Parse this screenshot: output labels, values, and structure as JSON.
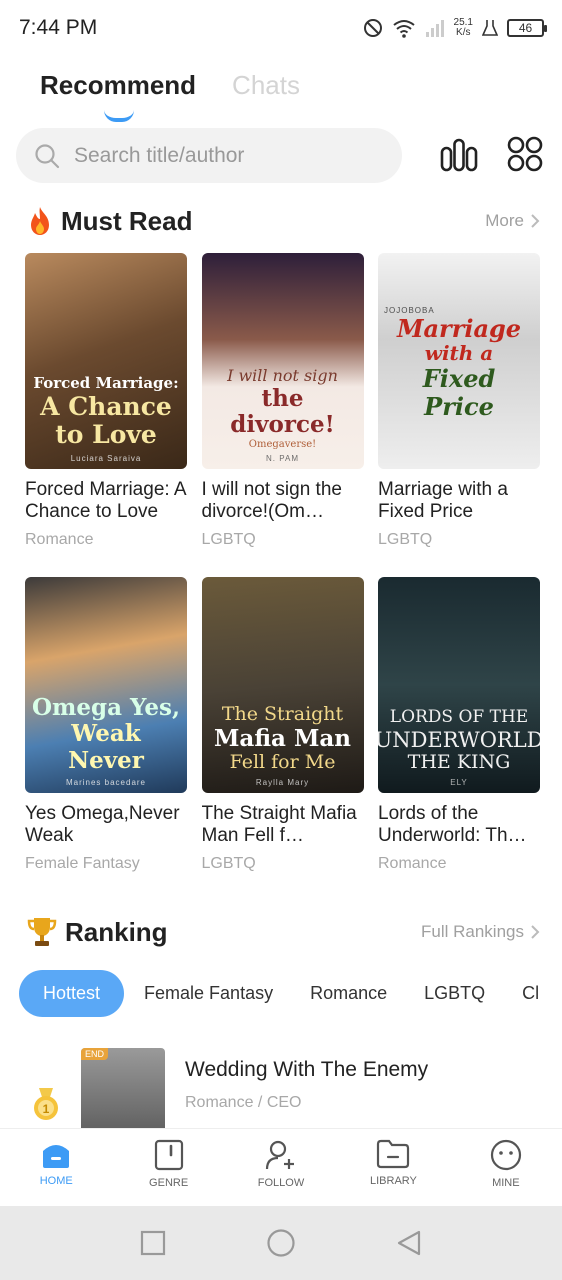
{
  "status_bar": {
    "time": "7:44 PM",
    "net_speed_value": "25.1",
    "net_speed_unit": "K/s",
    "battery": "46"
  },
  "top_tabs": [
    {
      "label": "Recommend",
      "active": true
    },
    {
      "label": "Chats",
      "active": false
    }
  ],
  "search": {
    "placeholder": "Search title/author"
  },
  "must_read": {
    "icon": "fire-icon",
    "title": "Must Read",
    "more": "More",
    "books": [
      {
        "title": "Forced Marriage: A Chance to Love",
        "genre": "Romance",
        "cover_title_1": "Forced Marriage:",
        "cover_title_2": "A Chance",
        "cover_title_3": "to Love",
        "cover_author": "Luciara Saraiva"
      },
      {
        "title": "I will not sign the divorce!(Om…",
        "genre": "LGBTQ",
        "cover_title_1": "I will not sign",
        "cover_title_2": "the divorce!",
        "cover_title_3": "Omegaverse!",
        "cover_author": "N. PAM"
      },
      {
        "title": "Marriage with a Fixed Price",
        "genre": "LGBTQ",
        "cover_title_1": "Marriage",
        "cover_title_2": "with a",
        "cover_title_3": "Fixed Price",
        "cover_author": "JOJOBOBA"
      },
      {
        "title": "Yes Omega,Never Weak",
        "genre": "Female Fantasy",
        "cover_title_1": "Omega Yes,",
        "cover_title_2": "Weak Never",
        "cover_title_3": "",
        "cover_author": "Marines bacedare"
      },
      {
        "title": "The Straight Mafia Man Fell f…",
        "genre": "LGBTQ",
        "cover_title_1": "The Straight",
        "cover_title_2": "Mafia Man",
        "cover_title_3": "Fell for Me",
        "cover_author": "Raylla Mary"
      },
      {
        "title": "Lords of the Underworld: Th…",
        "genre": "Romance",
        "cover_title_1": "LORDS OF THE",
        "cover_title_2": "UNDERWORLD",
        "cover_title_3": "THE KING",
        "cover_author": "ELY"
      }
    ]
  },
  "ranking": {
    "icon": "trophy-icon",
    "title": "Ranking",
    "full": "Full Rankings",
    "tabs": [
      "Hottest",
      "Female Fantasy",
      "Romance",
      "LGBTQ",
      "Cl"
    ],
    "active_tab": "Hottest",
    "items": [
      {
        "badge": "END",
        "title": "Wedding With The Enemy",
        "genre": "Romance / CEO"
      }
    ]
  },
  "bottom_nav": [
    {
      "label": "HOME",
      "icon": "home-icon",
      "active": true
    },
    {
      "label": "GENRE",
      "icon": "genre-icon",
      "active": false
    },
    {
      "label": "FOLLOW",
      "icon": "follow-icon",
      "active": false
    },
    {
      "label": "LIBRARY",
      "icon": "library-icon",
      "active": false
    },
    {
      "label": "MINE",
      "icon": "mine-icon",
      "active": false
    }
  ],
  "colors": {
    "accent": "#3d9bf5",
    "tab_active_bg": "#5aa8f6",
    "muted": "#a8a8a8"
  }
}
